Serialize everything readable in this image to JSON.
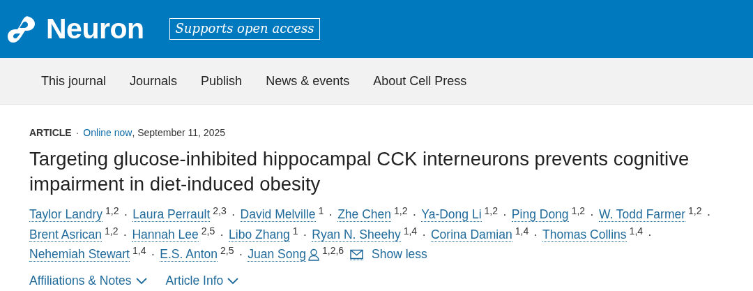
{
  "header": {
    "journal": "Neuron",
    "badge": "Supports open access"
  },
  "nav": {
    "items": [
      "This journal",
      "Journals",
      "Publish",
      "News & events",
      "About Cell Press"
    ]
  },
  "article": {
    "type": "ARTICLE",
    "separator": "·",
    "status": "Online now",
    "date": ", September 11, 2025",
    "title": "Targeting glucose-inhibited hippocampal CCK interneurons prevents cognitive impairment in diet-induced obesity",
    "author_lines": [
      [
        {
          "name": "Taylor Landry",
          "sup": "1,2"
        },
        {
          "name": "Laura Perrault",
          "sup": "2,3"
        },
        {
          "name": "David Melville",
          "sup": "1"
        },
        {
          "name": "Zhe Chen",
          "sup": "1,2"
        },
        {
          "name": "Ya-Dong Li",
          "sup": "1,2"
        },
        {
          "name": "Ping Dong",
          "sup": "1,2"
        },
        {
          "name": "W. Todd Farmer",
          "sup": "1,2"
        }
      ],
      [
        {
          "name": "Brent Asrican",
          "sup": "1,2"
        },
        {
          "name": "Hannah Lee",
          "sup": "2,5"
        },
        {
          "name": "Libo Zhang",
          "sup": "1"
        },
        {
          "name": "Ryan N. Sheehy",
          "sup": "1,4"
        },
        {
          "name": "Corina Damian",
          "sup": "1,4"
        },
        {
          "name": "Thomas Collins",
          "sup": "1,4"
        }
      ],
      [
        {
          "name": "Nehemiah Stewart",
          "sup": "1,4"
        },
        {
          "name": "E.S. Anton",
          "sup": "2,5"
        },
        {
          "name": "Juan Song",
          "sup": "1,2,6",
          "corresponding": true,
          "email": true
        }
      ]
    ],
    "show_less": "Show less",
    "sections": [
      {
        "label": "Affiliations & Notes",
        "expanded": false
      },
      {
        "label": "Article Info",
        "expanded": false
      }
    ]
  }
}
